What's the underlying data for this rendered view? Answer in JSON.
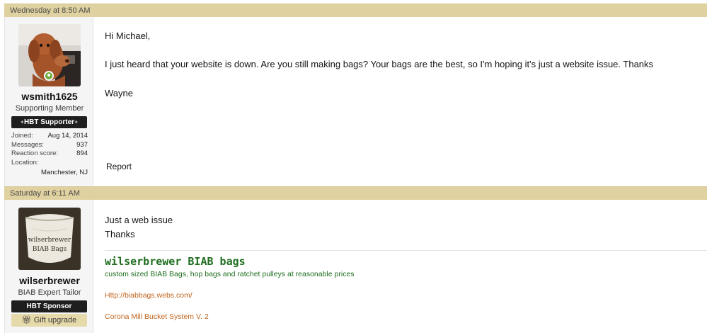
{
  "posts": [
    {
      "timestamp": "Wednesday at 8:50 AM",
      "author": {
        "username": "wsmith1625",
        "title": "Supporting Member",
        "banner": "HBT Supporter",
        "online": true,
        "stats": [
          {
            "label": "Joined:",
            "value": "Aug 14, 2014"
          },
          {
            "label": "Messages:",
            "value": "937"
          },
          {
            "label": "Reaction score:",
            "value": "894"
          },
          {
            "label": "Location:",
            "value": ""
          }
        ],
        "location": "Manchester, NJ"
      },
      "message": {
        "greeting": "Hi Michael,",
        "body": "I just heard that your website is down. Are you still making bags? Your bags are the best, so I'm hoping it's just a website issue. Thanks",
        "signoff": "Wayne"
      },
      "report_label": "Report"
    },
    {
      "timestamp": "Saturday at 6:11 AM",
      "author": {
        "username": "wilserbrewer",
        "title": "BIAB Expert Tailor",
        "banner": "HBT Sponsor",
        "gift_button": "Gift upgrade",
        "gift_icon": "gift-icon",
        "avatar_text": [
          "wilserbrewer",
          "BIAB Bags"
        ]
      },
      "message": {
        "line1": "Just a web issue",
        "line2": "Thanks"
      },
      "signature": {
        "title": "wilserbrewer BIAB bags",
        "tagline": "custom sized BIAB Bags, hop bags and ratchet pulleys at reasonable prices",
        "link1": "Http://biabbags.webs.com/",
        "link2": "Corona Mill Bucket System V. 2"
      }
    }
  ]
}
